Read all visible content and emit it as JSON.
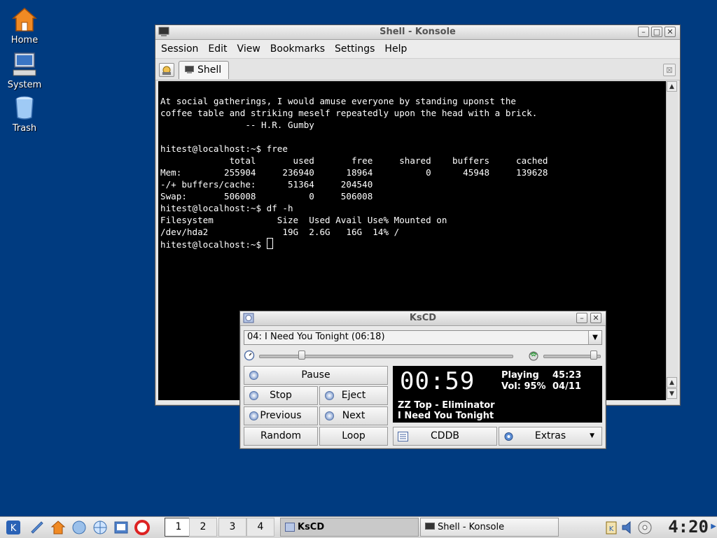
{
  "desktop": {
    "icons": [
      {
        "label": "Home"
      },
      {
        "label": "System"
      },
      {
        "label": "Trash"
      }
    ]
  },
  "konsole": {
    "title": "Shell - Konsole",
    "menu": [
      "Session",
      "Edit",
      "View",
      "Bookmarks",
      "Settings",
      "Help"
    ],
    "tab_label": "Shell",
    "terminal_lines": [
      "",
      "At social gatherings, I would amuse everyone by standing uponst the",
      "coffee table and striking meself repeatedly upon the head with a brick.",
      "                -- H.R. Gumby",
      "",
      "hitest@localhost:~$ free",
      "             total       used       free     shared    buffers     cached",
      "Mem:        255904     236940      18964          0      45948     139628",
      "-/+ buffers/cache:      51364     204540",
      "Swap:       506008          0     506008",
      "hitest@localhost:~$ df -h",
      "Filesystem            Size  Used Avail Use% Mounted on",
      "/dev/hda2              19G  2.6G   16G  14% /"
    ],
    "prompt": "hitest@localhost:~$ "
  },
  "kscd": {
    "title": "KsCD",
    "track_selected": "04: I Need You Tonight (06:18)",
    "position_fraction": 0.16,
    "volume_fraction": 0.95,
    "buttons": {
      "pause": "Pause",
      "stop": "Stop",
      "eject": "Eject",
      "previous": "Previous",
      "next": "Next",
      "random": "Random",
      "loop": "Loop",
      "cddb": "CDDB",
      "extras": "Extras"
    },
    "display": {
      "time": "00:59",
      "status": "Playing",
      "volume": "Vol: 95%",
      "total_time": "45:23",
      "track_count": "04/11",
      "artist_album": "ZZ Top - Eliminator",
      "track_name": "I Need You Tonight"
    }
  },
  "taskbar": {
    "desktops": [
      "1",
      "2",
      "3",
      "4"
    ],
    "tasks": [
      {
        "label": "KsCD"
      },
      {
        "label": "Shell - Konsole"
      }
    ],
    "clock": "4:20"
  },
  "colors": {
    "desktop_bg": "#003b80",
    "terminal_bg": "#000000",
    "terminal_fg": "#ffffff"
  }
}
